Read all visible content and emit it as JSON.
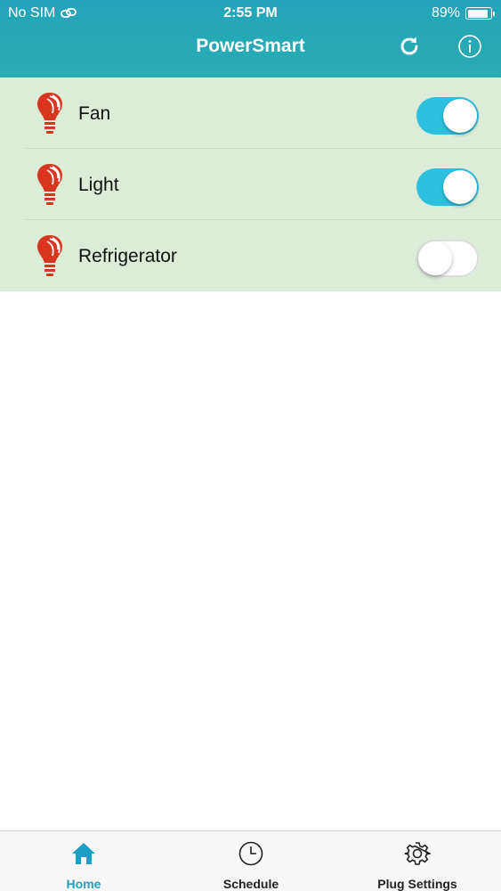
{
  "status_bar": {
    "carrier": "No SIM",
    "time": "2:55 PM",
    "battery_percent": "89%",
    "battery_level": 0.89
  },
  "header": {
    "title": "PowerSmart",
    "refresh_icon": "refresh-icon",
    "info_icon": "info-icon",
    "background": "#23a4bd"
  },
  "devices": [
    {
      "name": "Fan",
      "on": true
    },
    {
      "name": "Light",
      "on": true
    },
    {
      "name": "Refrigerator",
      "on": false
    }
  ],
  "colors": {
    "toggle_on": "#2ec1df",
    "list_background": "#dcecd9",
    "bulb": "#d9361f",
    "tab_active": "#1f9fc4"
  },
  "tabs": [
    {
      "label": "Home",
      "icon": "home-icon",
      "active": true
    },
    {
      "label": "Schedule",
      "icon": "clock-icon",
      "active": false
    },
    {
      "label": "Plug Settings",
      "icon": "gear-icon",
      "active": false
    }
  ]
}
